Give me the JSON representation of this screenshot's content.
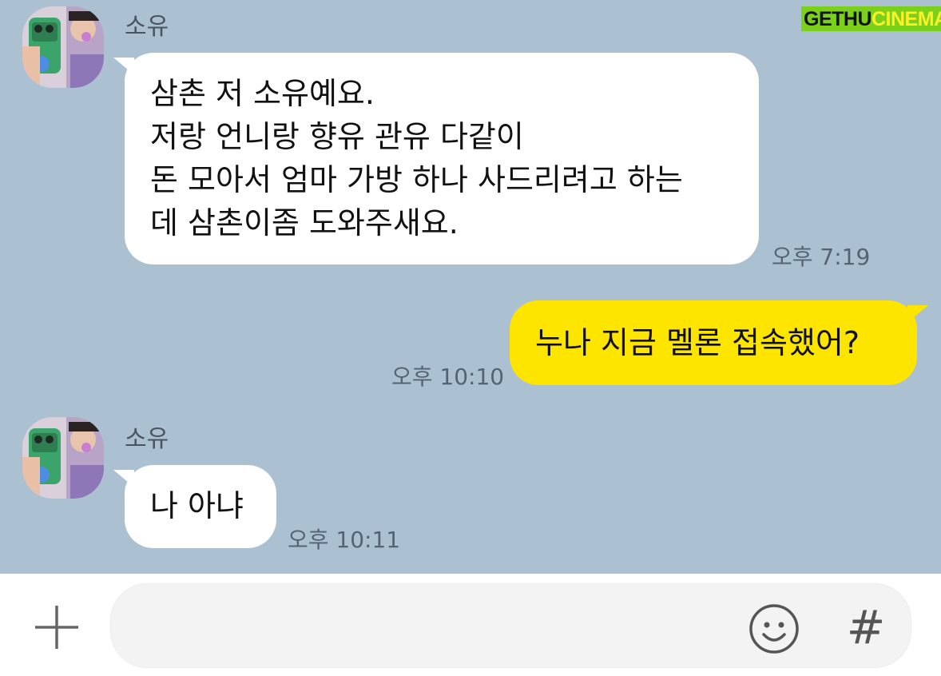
{
  "watermark": {
    "gethu": "GETHU",
    "cinema": "CINEMA"
  },
  "messages": [
    {
      "sender": "소유",
      "text": "삼촌 저 소유예요.\n저랑 언니랑 향유 관유 다같이\n돈 모아서 엄마 가방 하나 사드리려고 하는\n데 삼촌이좀 도와주새요.",
      "time": "오후 7:19"
    },
    {
      "text": "누나 지금 멜론 접속했어?",
      "time": "오후 10:10"
    },
    {
      "sender": "소유",
      "text": "나 아냐",
      "time": "오후 10:11"
    }
  ],
  "input": {
    "placeholder": "",
    "value": ""
  },
  "icons": {
    "attach": "plus-icon",
    "emoji": "emoji-smile-icon",
    "hashtag": "hashtag-icon"
  },
  "hashtag_glyph": "#",
  "colors": {
    "chat_background": "#abc1d1",
    "my_bubble": "#fee500",
    "their_bubble": "#ffffff"
  }
}
